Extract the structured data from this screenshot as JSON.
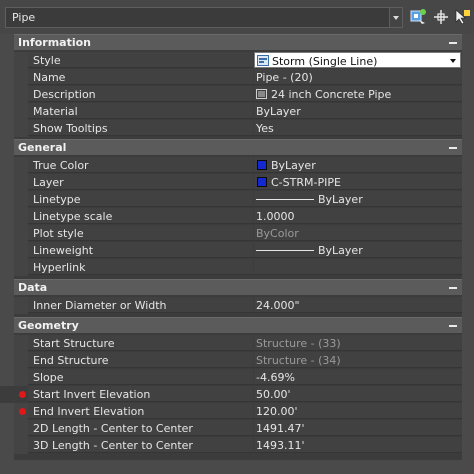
{
  "toolbar": {
    "selector_value": "Pipe",
    "buttons": [
      "quick-select-icon",
      "select-objects-icon",
      "toggle-pickadd-icon"
    ]
  },
  "sections": {
    "information": {
      "title": "Information",
      "rows": {
        "style": {
          "label": "Style",
          "value": "Storm (Single Line)"
        },
        "name": {
          "label": "Name",
          "value": "Pipe - (20)"
        },
        "description": {
          "label": "Description",
          "value": "24 inch Concrete Pipe"
        },
        "material": {
          "label": "Material",
          "value": "ByLayer"
        },
        "show_tooltips": {
          "label": "Show Tooltips",
          "value": "Yes"
        }
      }
    },
    "general": {
      "title": "General",
      "rows": {
        "true_color": {
          "label": "True Color",
          "value": "ByLayer",
          "swatch": "#1428d2"
        },
        "layer": {
          "label": "Layer",
          "value": "C-STRM-PIPE",
          "swatch": "#1428d2"
        },
        "linetype": {
          "label": "Linetype",
          "value": "ByLayer"
        },
        "linetype_scale": {
          "label": "Linetype scale",
          "value": "1.0000"
        },
        "plot_style": {
          "label": "Plot style",
          "value": "ByColor"
        },
        "lineweight": {
          "label": "Lineweight",
          "value": "ByLayer"
        },
        "hyperlink": {
          "label": "Hyperlink",
          "value": ""
        }
      }
    },
    "data": {
      "title": "Data",
      "rows": {
        "inner_diameter": {
          "label": "Inner Diameter or Width",
          "value": "24.000\""
        }
      }
    },
    "geometry": {
      "title": "Geometry",
      "rows": {
        "start_structure": {
          "label": "Start Structure",
          "value": "Structure - (33)"
        },
        "end_structure": {
          "label": "End Structure",
          "value": "Structure - (34)"
        },
        "slope": {
          "label": "Slope",
          "value": "-4.69%"
        },
        "start_invert": {
          "label": "Start Invert Elevation",
          "value": "50.00'"
        },
        "end_invert": {
          "label": "End Invert Elevation",
          "value": "120.00'"
        },
        "length_2d": {
          "label": "2D Length - Center to Center",
          "value": "1491.47'"
        },
        "length_3d": {
          "label": "3D Length - Center to Center",
          "value": "1493.11'"
        }
      }
    }
  },
  "colors": {
    "swatch_blue": "#1428d2",
    "modified_marker": "#e01818"
  }
}
